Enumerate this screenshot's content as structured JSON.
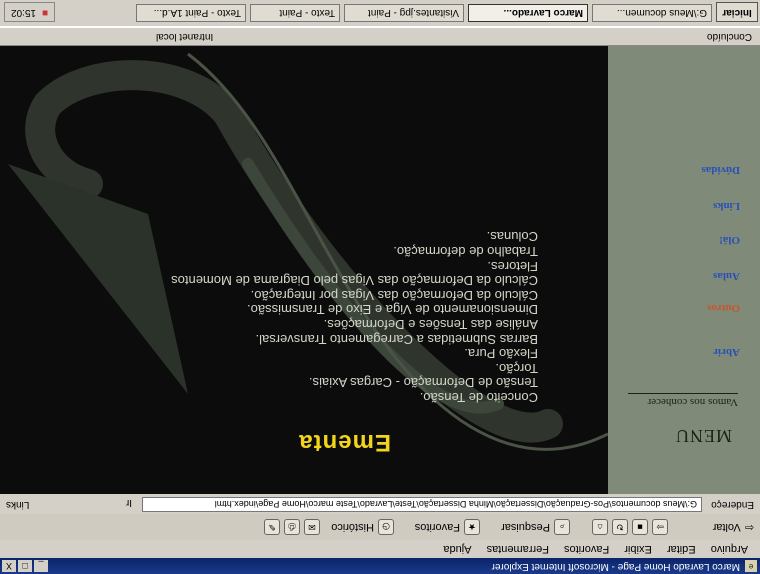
{
  "window": {
    "title": "Marco Lavrado Home Page - Microsoft Internet Explorer",
    "controls": [
      "_",
      "□",
      "X"
    ]
  },
  "menubar": [
    "Arquivo",
    "Editar",
    "Exibir",
    "Favoritos",
    "Ferramentas",
    "Ajuda"
  ],
  "toolbar": {
    "back": "Voltar",
    "search": "Pesquisar",
    "favorites": "Favoritos",
    "history": "Histórico"
  },
  "address": {
    "label": "Endereço",
    "value": "G:\\Meus documentos\\Pos-Graduação\\Dissertação\\Minha Dissertação\\Teste\\Lavrado\\Teste marco\\Home Page\\index.html",
    "go": "Ir",
    "links": "Links"
  },
  "menu": {
    "title": "MENU",
    "vamos": "Vamos nos conhecer",
    "items": [
      "Abrir",
      "Outros",
      "Aulas",
      "Olá!",
      "Links",
      "Dúvidas"
    ]
  },
  "content": {
    "heading": "Ementa",
    "topics": [
      "Conceito de Tensão.",
      "Tensão de Deformação - Cargas Axiais.",
      "Torção.",
      "Flexão Pura.",
      "Barras Submetidas a Carregamento Transversal.",
      "Análise das Tensões e Deformações.",
      "Dimensionamento de Viga e Eixo de Transmissão.",
      "Cálculo da Deformação das Vigas por Integração.",
      "Cálculo da Deformação das Vigas pelo Diagrama de Momentos",
      "Fletores.",
      "Trabalho de deformação.",
      "Colunas."
    ]
  },
  "status": {
    "left": "Concluído",
    "zone": "Intranet local"
  },
  "taskbar": {
    "start": "Iniciar",
    "tasks": [
      "G:\\Meus documen...",
      "Marco Lavrado...",
      "Visitantes.jpg - Paint",
      "Texto - Paint",
      "Texto - Paint 1A.d..."
    ],
    "time": "15:02"
  },
  "colors": {
    "heading": "#f2d41a",
    "menuBg": "#7f8b78",
    "contentBg": "#0b0c0b",
    "link": "#2a50b8"
  }
}
